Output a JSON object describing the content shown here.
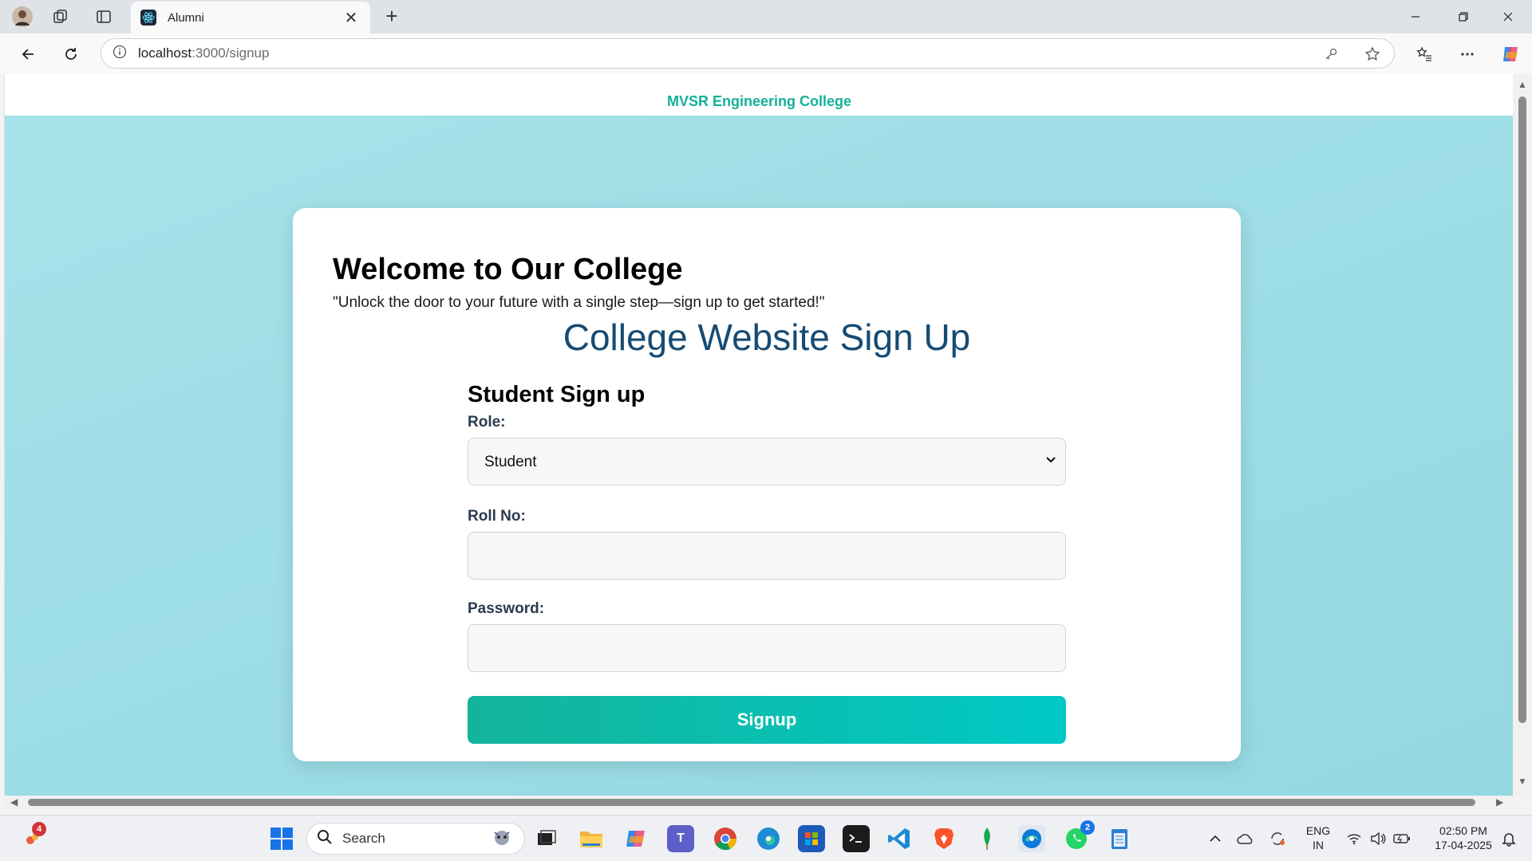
{
  "browser": {
    "tab_title": "Alumni",
    "url_host": "localhost",
    "url_path": ":3000/signup"
  },
  "page": {
    "header_title": "MVSR Engineering College",
    "welcome_heading": "Welcome to Our College",
    "tagline": "\"Unlock the door to your future with a single step—sign up to get started!\"",
    "form_title": "College Website Sign Up",
    "subform_title": "Student Sign up",
    "role_label": "Role:",
    "role_value": "Student",
    "rollno_label": "Roll No:",
    "rollno_value": "",
    "password_label": "Password:",
    "password_value": "",
    "signup_button": "Signup"
  },
  "taskbar": {
    "search_placeholder": "Search",
    "notification_count": "4",
    "whatsapp_badge": "2",
    "lang_line1": "ENG",
    "lang_line2": "IN",
    "time": "02:50 PM",
    "date": "17-04-2025"
  },
  "colors": {
    "header_accent": "#14b09a",
    "form_title": "#164b73",
    "button_start": "#14b49b",
    "button_end": "#00c9c6",
    "page_bg": "#a6e2ea"
  }
}
